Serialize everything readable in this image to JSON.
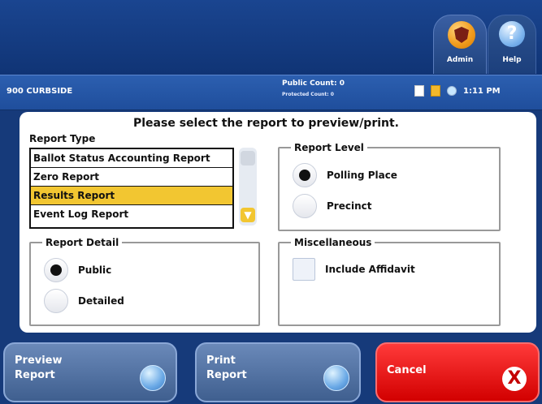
{
  "header": {
    "admin_label": "Admin",
    "help_label": "Help"
  },
  "status": {
    "location": "900 CURBSIDE",
    "public_count": "Public Count: 0",
    "protected_count": "Protected Count: 0",
    "time": "1:11 PM"
  },
  "panel": {
    "heading": "Please select the report to preview/print.",
    "report_type_label": "Report Type",
    "report_types": [
      "Ballot Status Accounting Report",
      "Zero Report",
      "Results Report",
      "Event Log Report"
    ],
    "selected_report_index": 2,
    "report_level": {
      "label": "Report Level",
      "options": [
        "Polling Place",
        "Precinct"
      ],
      "selected": "Polling Place"
    },
    "report_detail": {
      "label": "Report Detail",
      "options": [
        "Public",
        "Detailed"
      ],
      "selected": "Public"
    },
    "misc": {
      "label": "Miscellaneous",
      "include_affidavit_label": "Include Affidavit",
      "include_affidavit_checked": false
    }
  },
  "buttons": {
    "preview_line1": "Preview",
    "preview_line2": "Report",
    "print_line1": "Print",
    "print_line2": "Report",
    "cancel": "Cancel"
  },
  "colors": {
    "accent_yellow": "#f2c631",
    "cancel_red": "#e00000",
    "header_blue": "#1a4590"
  },
  "icons": {
    "admin": "shield-icon",
    "help": "question-icon",
    "status1": "document-icon",
    "status2": "save-icon",
    "status3": "network-icon"
  }
}
